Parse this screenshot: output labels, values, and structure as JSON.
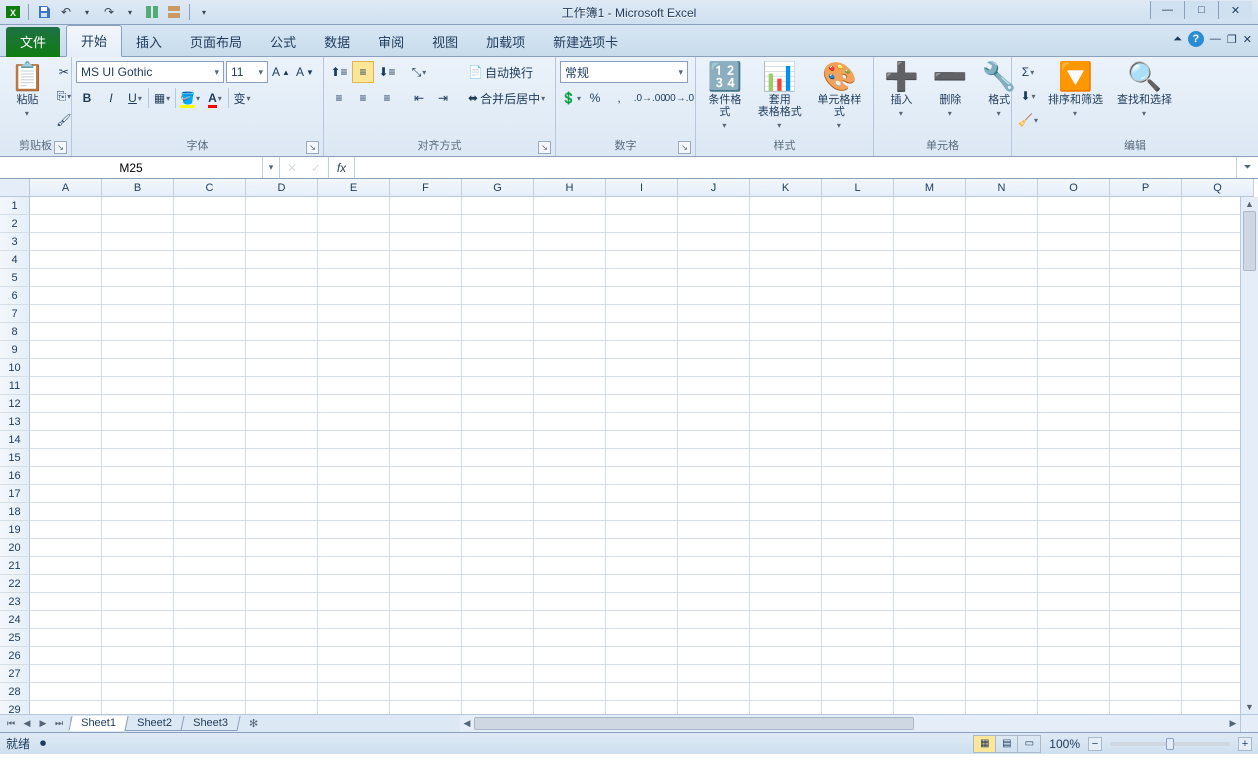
{
  "title": "工作簿1 - Microsoft Excel",
  "tabs": {
    "file": "文件",
    "list": [
      "开始",
      "插入",
      "页面布局",
      "公式",
      "数据",
      "审阅",
      "视图",
      "加载项",
      "新建选项卡"
    ],
    "active_index": 0
  },
  "ribbon": {
    "clipboard": {
      "label": "剪贴板",
      "paste": "粘贴"
    },
    "font": {
      "label": "字体",
      "name": "MS UI Gothic",
      "size": "11"
    },
    "alignment": {
      "label": "对齐方式",
      "wrap": "自动换行",
      "merge": "合并后居中"
    },
    "number": {
      "label": "数字",
      "format": "常规"
    },
    "styles": {
      "label": "样式",
      "cond": "条件格式",
      "table": "套用\n表格格式",
      "cell": "单元格样式"
    },
    "cells": {
      "label": "单元格",
      "insert": "插入",
      "delete": "删除",
      "format": "格式"
    },
    "editing": {
      "label": "编辑",
      "sort": "排序和筛选",
      "find": "查找和选择"
    }
  },
  "formula_bar": {
    "name_box": "M25",
    "fx": "fx",
    "formula": ""
  },
  "columns": [
    "A",
    "B",
    "C",
    "D",
    "E",
    "F",
    "G",
    "H",
    "I",
    "J",
    "K",
    "L",
    "M",
    "N",
    "O",
    "P",
    "Q"
  ],
  "rows": [
    1,
    2,
    3,
    4,
    5,
    6,
    7,
    8,
    9,
    10,
    11,
    12,
    13,
    14,
    15,
    16,
    17,
    18,
    19,
    20,
    21,
    22,
    23,
    24,
    25,
    26,
    27,
    28,
    29
  ],
  "sheets": [
    "Sheet1",
    "Sheet2",
    "Sheet3"
  ],
  "status": {
    "ready": "就绪",
    "zoom": "100%"
  }
}
